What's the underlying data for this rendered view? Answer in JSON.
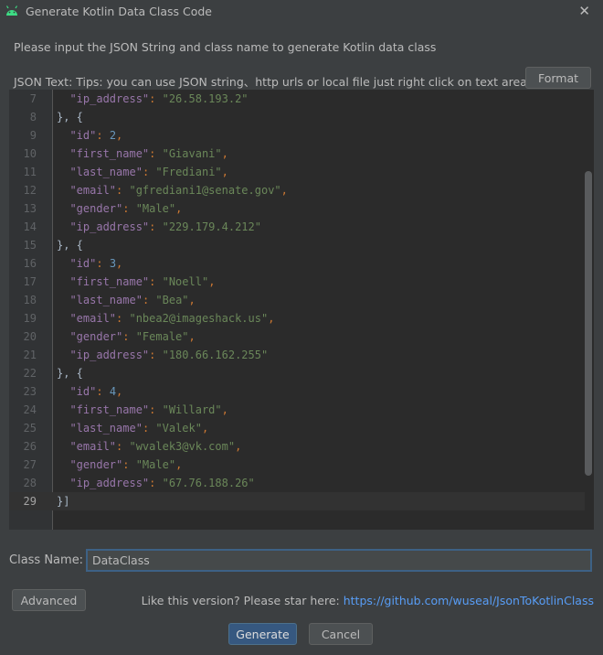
{
  "window": {
    "title": "Generate Kotlin Data Class Code"
  },
  "instruction": "Please input the JSON String and class name to generate Kotlin data class",
  "json_label": "JSON Text:",
  "json_tips": "Tips: you can use JSON string、http urls or local file just right click on text area",
  "format_button": "Format",
  "editor": {
    "current_line": 29,
    "lines": [
      {
        "no": "7",
        "indent": "  ",
        "key": "\"ip_address\"",
        "value": "\"26.58.193.2\"",
        "vtype": "s",
        "comma": false
      },
      {
        "no": "8",
        "raw": "}, {"
      },
      {
        "no": "9",
        "indent": "  ",
        "key": "\"id\"",
        "value": "2",
        "vtype": "n",
        "comma": true
      },
      {
        "no": "10",
        "indent": "  ",
        "key": "\"first_name\"",
        "value": "\"Giavani\"",
        "vtype": "s",
        "comma": true
      },
      {
        "no": "11",
        "indent": "  ",
        "key": "\"last_name\"",
        "value": "\"Frediani\"",
        "vtype": "s",
        "comma": true
      },
      {
        "no": "12",
        "indent": "  ",
        "key": "\"email\"",
        "value": "\"gfrediani1@senate.gov\"",
        "vtype": "s",
        "comma": true
      },
      {
        "no": "13",
        "indent": "  ",
        "key": "\"gender\"",
        "value": "\"Male\"",
        "vtype": "s",
        "comma": true
      },
      {
        "no": "14",
        "indent": "  ",
        "key": "\"ip_address\"",
        "value": "\"229.179.4.212\"",
        "vtype": "s",
        "comma": false
      },
      {
        "no": "15",
        "raw": "}, {"
      },
      {
        "no": "16",
        "indent": "  ",
        "key": "\"id\"",
        "value": "3",
        "vtype": "n",
        "comma": true
      },
      {
        "no": "17",
        "indent": "  ",
        "key": "\"first_name\"",
        "value": "\"Noell\"",
        "vtype": "s",
        "comma": true
      },
      {
        "no": "18",
        "indent": "  ",
        "key": "\"last_name\"",
        "value": "\"Bea\"",
        "vtype": "s",
        "comma": true
      },
      {
        "no": "19",
        "indent": "  ",
        "key": "\"email\"",
        "value": "\"nbea2@imageshack.us\"",
        "vtype": "s",
        "comma": true
      },
      {
        "no": "20",
        "indent": "  ",
        "key": "\"gender\"",
        "value": "\"Female\"",
        "vtype": "s",
        "comma": true
      },
      {
        "no": "21",
        "indent": "  ",
        "key": "\"ip_address\"",
        "value": "\"180.66.162.255\"",
        "vtype": "s",
        "comma": false
      },
      {
        "no": "22",
        "raw": "}, {"
      },
      {
        "no": "23",
        "indent": "  ",
        "key": "\"id\"",
        "value": "4",
        "vtype": "n",
        "comma": true
      },
      {
        "no": "24",
        "indent": "  ",
        "key": "\"first_name\"",
        "value": "\"Willard\"",
        "vtype": "s",
        "comma": true
      },
      {
        "no": "25",
        "indent": "  ",
        "key": "\"last_name\"",
        "value": "\"Valek\"",
        "vtype": "s",
        "comma": true
      },
      {
        "no": "26",
        "indent": "  ",
        "key": "\"email\"",
        "value": "\"wvalek3@vk.com\"",
        "vtype": "s",
        "comma": true
      },
      {
        "no": "27",
        "indent": "  ",
        "key": "\"gender\"",
        "value": "\"Male\"",
        "vtype": "s",
        "comma": true
      },
      {
        "no": "28",
        "indent": "  ",
        "key": "\"ip_address\"",
        "value": "\"67.76.188.26\"",
        "vtype": "s",
        "comma": false
      },
      {
        "no": "29",
        "raw": "}]"
      }
    ]
  },
  "class_name": {
    "label": "Class Name:",
    "value": "DataClass"
  },
  "advanced_button": "Advanced",
  "star_text": "Like this version? Please star here:",
  "star_link": "https://github.com/wuseal/JsonToKotlinClass",
  "generate_button": "Generate",
  "cancel_button": "Cancel",
  "colors": {
    "background": "#3c3f41",
    "editor_bg": "#2b2b2b",
    "json_key": "#9876aa",
    "json_string": "#6a8759",
    "json_number": "#6897bb",
    "link": "#589df6",
    "primary_button": "#365880"
  },
  "icons": {
    "app": "android-icon",
    "close": "close-icon"
  }
}
